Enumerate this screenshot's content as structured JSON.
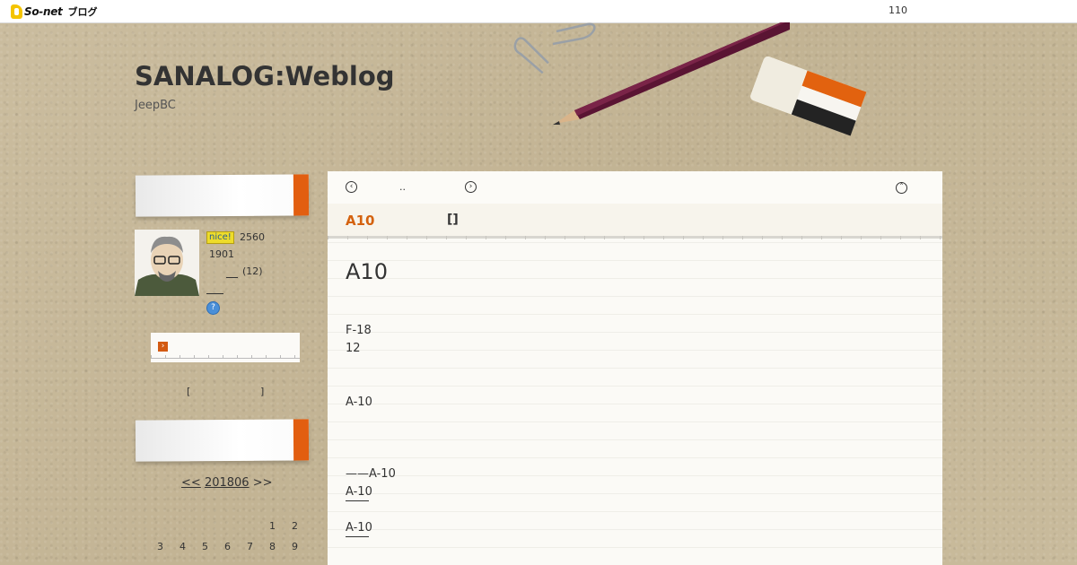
{
  "topbar": {
    "brand": "So-net",
    "brand_sub": "ブログ",
    "count": "110"
  },
  "header": {
    "title": "SANALOG:Weblog",
    "description": "JeepBC"
  },
  "profile": {
    "nice_badge": "nice!",
    "nice_count": "2560",
    "reader_count": "1901",
    "paren_count": "(12)",
    "help_icon_label": "?"
  },
  "search": {
    "bracket_left": "[",
    "bracket_right": "]",
    "button_icon": "›"
  },
  "calendar": {
    "prev": "<<",
    "month": "201806",
    "next": ">>",
    "rows": [
      [
        "",
        "",
        "",
        "",
        "",
        "1",
        "2"
      ],
      [
        "3",
        "4",
        "5",
        "6",
        "7",
        "8",
        "9"
      ]
    ]
  },
  "article_nav": {
    "prev_icon": "‹",
    "dots": "..",
    "next_icon": "›",
    "top_icon": "˄"
  },
  "article": {
    "category": "A10",
    "category_brackets": "[]",
    "title": "A10",
    "lines": [
      "F-18",
      "12",
      "A-10",
      "——A-10",
      "A-10",
      "A-10"
    ]
  },
  "colors": {
    "accent": "#e25e10",
    "category": "#d4620f",
    "nice_badge": "#eedc2a"
  }
}
